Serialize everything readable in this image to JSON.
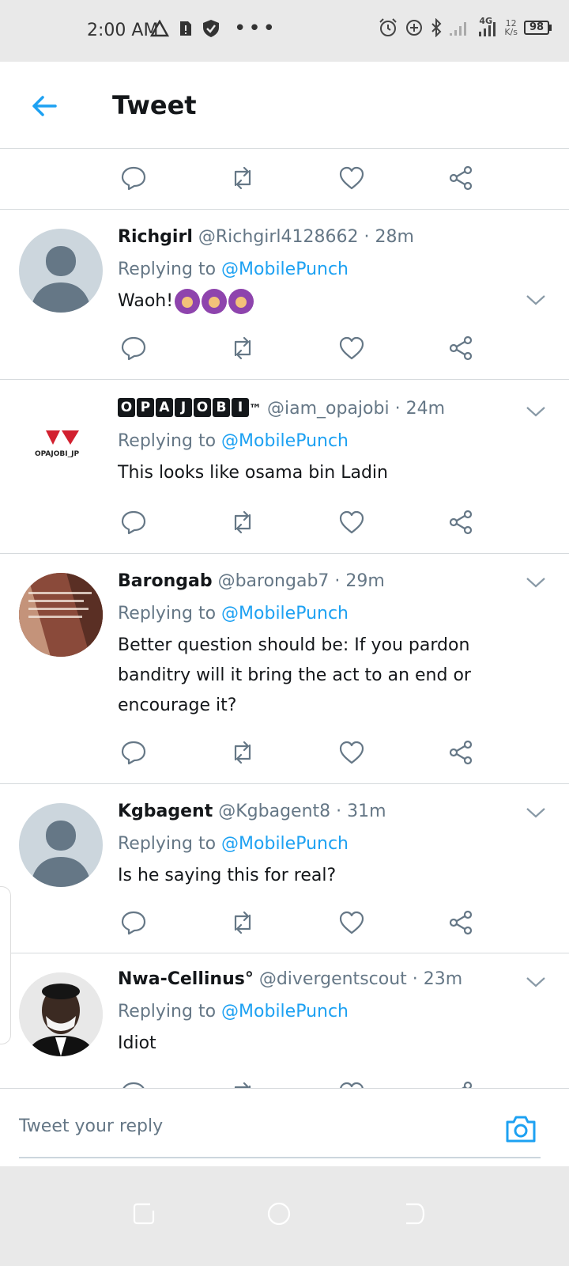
{
  "status_bar": {
    "time": "2:00 AM",
    "network_speed_value": "12",
    "network_speed_unit": "K/s",
    "signal_label": "4G",
    "battery": "98",
    "icons": [
      "warning-icon",
      "sim-alert-icon",
      "shield-icon",
      "more-dots-icon",
      "alarm-icon",
      "data-saver-icon",
      "bluetooth-icon",
      "signal-icon",
      "network-icon"
    ]
  },
  "header": {
    "title": "Tweet",
    "back_icon": "arrow-left-icon"
  },
  "colors": {
    "accent": "#1da1f2",
    "text_primary": "#14171a",
    "text_secondary": "#657786",
    "divider": "#d6dadd"
  },
  "tweets": [
    {
      "name": "Richgirl",
      "handle": "@Richgirl4128662",
      "time": "· 28m",
      "replying_prefix": "Replying to",
      "replying_to": "@MobilePunch",
      "text": "Waoh!",
      "emoji_count": 3,
      "avatar": "default-avatar"
    },
    {
      "name_letters": [
        "O",
        "P",
        "A",
        "J",
        "O",
        "B",
        "I"
      ],
      "name_suffix": "™",
      "handle": "@iam_opajobi",
      "time": "· 24m",
      "replying_prefix": "Replying to",
      "replying_to": "@MobilePunch",
      "text": "This looks like osama bin Ladin",
      "avatar": "opajobi-logo",
      "avatar_text": "OPAJOBI_JP"
    },
    {
      "name": "Barongab",
      "handle": "@barongab7",
      "time": "· 29m",
      "replying_prefix": "Replying to",
      "replying_to": "@MobilePunch",
      "text": "Better question should be: If you pardon banditry will it bring the act to an end or encourage it?",
      "avatar": "quote-photo-avatar"
    },
    {
      "name": "Kgbagent",
      "handle": "@Kgbagent8",
      "time": "· 31m",
      "replying_prefix": "Replying to",
      "replying_to": "@MobilePunch",
      "text": "Is he saying this for real?",
      "avatar": "default-avatar"
    },
    {
      "name": "Nwa-Cellinus°",
      "handle": "@divergentscout",
      "time": "· 23m",
      "replying_prefix": "Replying to",
      "replying_to": "@MobilePunch",
      "text": "Idiot",
      "avatar": "photo-avatar"
    }
  ],
  "reply_bar": {
    "placeholder": "Tweet your reply",
    "camera_icon": "camera-icon"
  },
  "nav_bar": {
    "buttons": [
      "recents-icon",
      "home-icon",
      "back-icon"
    ]
  }
}
